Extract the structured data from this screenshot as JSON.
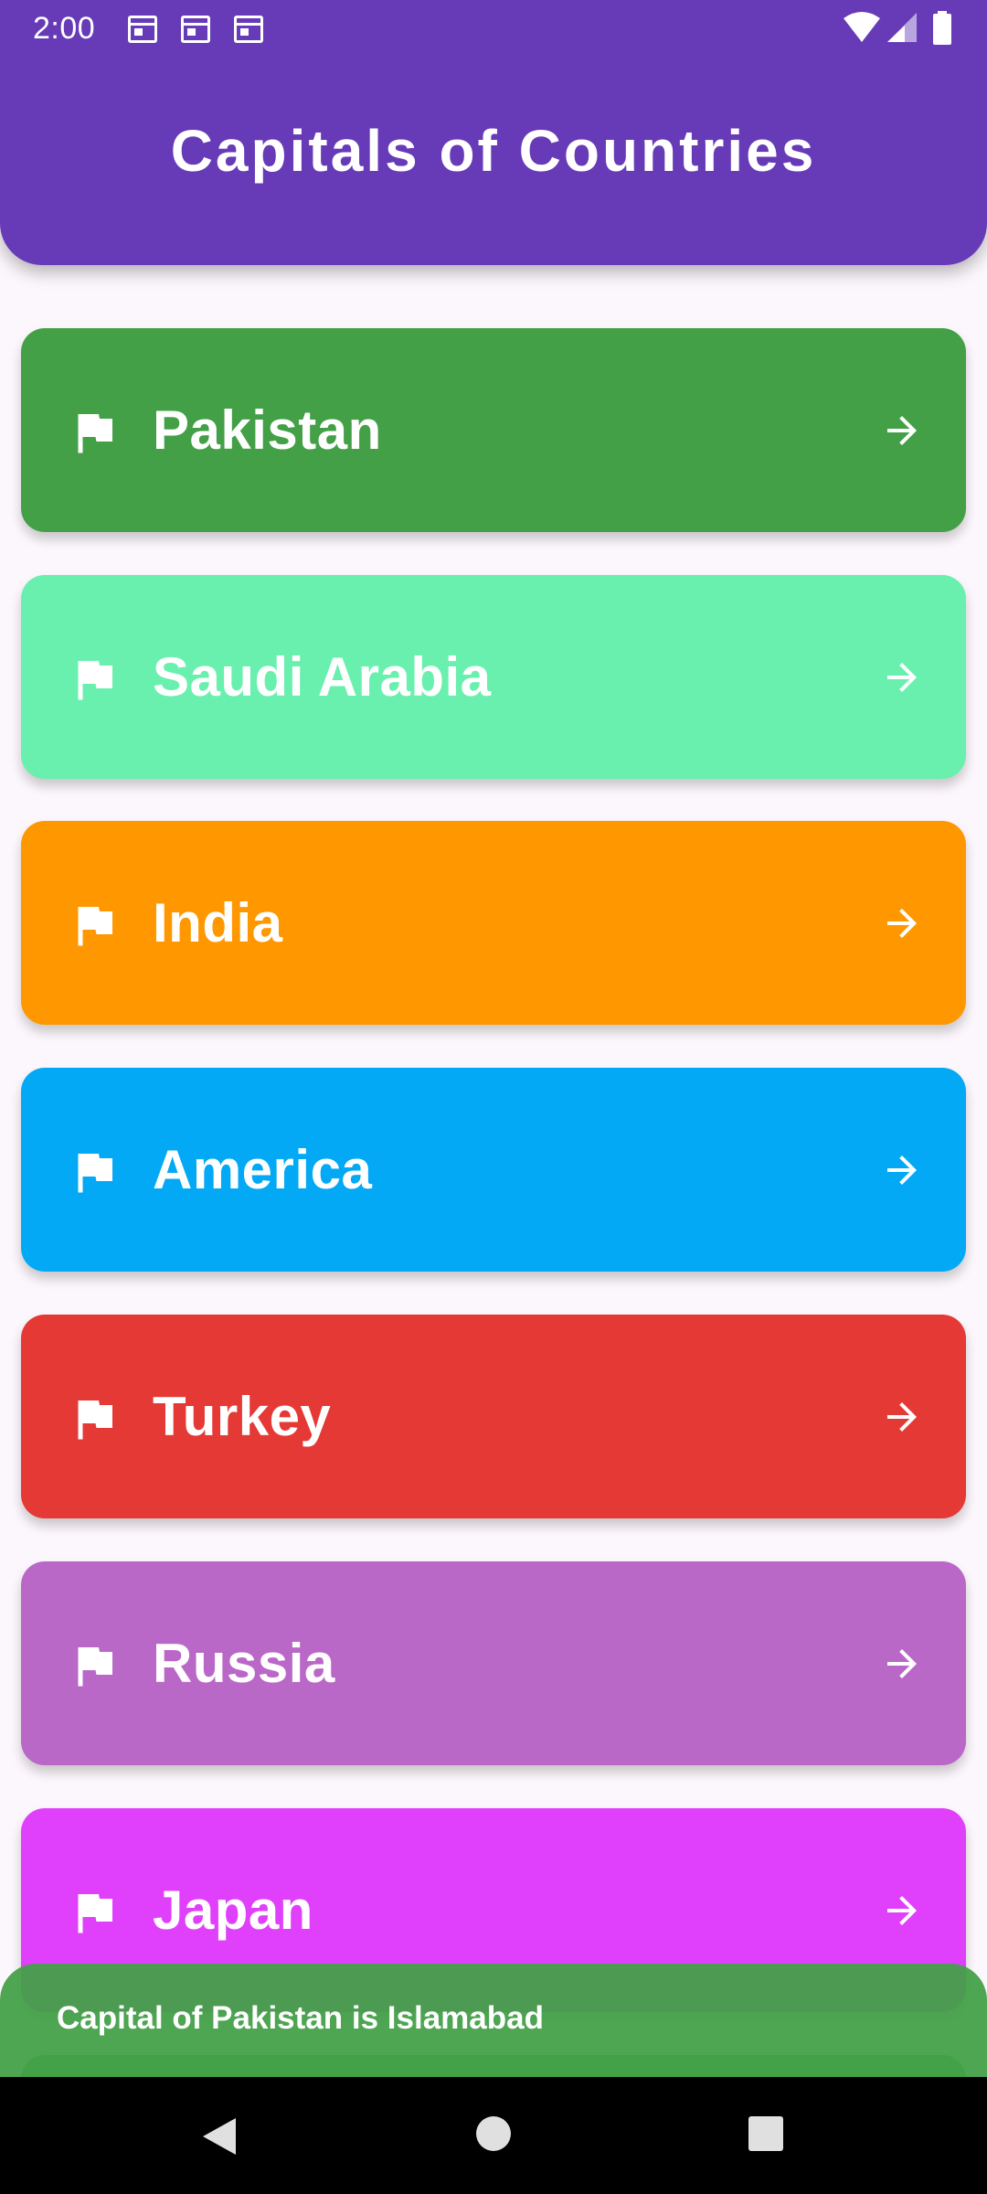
{
  "status_bar": {
    "time": "2:00",
    "notification_icons": [
      "calendar-icon",
      "calendar-icon",
      "calendar-icon"
    ],
    "system_icons": [
      "wifi-icon",
      "signal-icon",
      "battery-icon"
    ]
  },
  "app_bar": {
    "title": "Capitals of Countries",
    "color": "#673ab7"
  },
  "countries": [
    {
      "name": "Pakistan",
      "color": "#43a047",
      "icon": "flag-icon",
      "trailing_icon": "arrow-forward-icon"
    },
    {
      "name": "Saudi Arabia",
      "color": "#69f0ae",
      "icon": "flag-icon",
      "trailing_icon": "arrow-forward-icon"
    },
    {
      "name": "India",
      "color": "#ff9800",
      "icon": "flag-icon",
      "trailing_icon": "arrow-forward-icon"
    },
    {
      "name": "America",
      "color": "#03a9f4",
      "icon": "flag-icon",
      "trailing_icon": "arrow-forward-icon"
    },
    {
      "name": "Turkey",
      "color": "#e53935",
      "icon": "flag-icon",
      "trailing_icon": "arrow-forward-icon"
    },
    {
      "name": "Russia",
      "color": "#ba68c8",
      "icon": "flag-icon",
      "trailing_icon": "arrow-forward-icon"
    },
    {
      "name": "Japan",
      "color": "#e040fb",
      "icon": "flag-icon",
      "trailing_icon": "arrow-forward-icon"
    },
    {
      "name": "",
      "color": "#43a047",
      "icon": "",
      "trailing_icon": ""
    }
  ],
  "snackbar": {
    "message": "Capital of Pakistan is Islamabad",
    "color": "#43a047"
  },
  "nav_bar": {
    "buttons": [
      "back-icon",
      "home-icon",
      "recents-icon"
    ]
  }
}
